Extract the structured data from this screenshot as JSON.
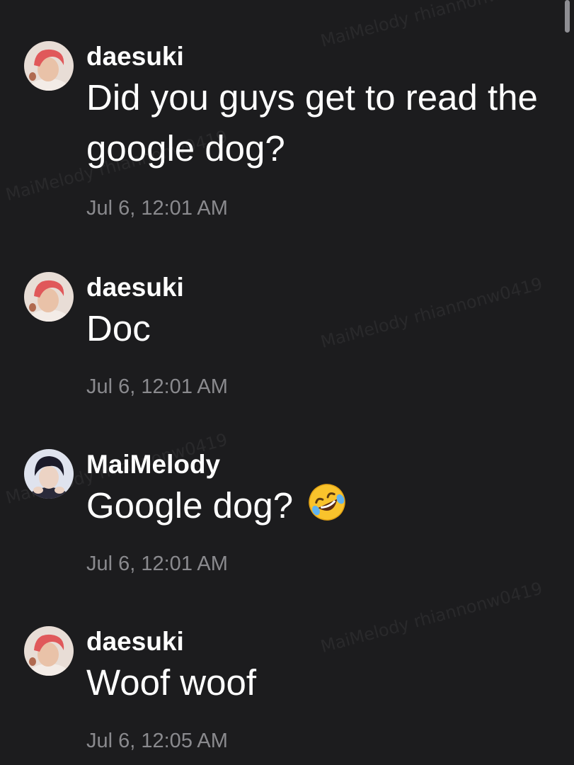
{
  "watermark_text": "MaiMelody rhiannonw0419",
  "messages": [
    {
      "user": "daesuki",
      "text": "Did you guys get to read the google dog?",
      "time": "Jul 6, 12:01 AM",
      "avatar": "daesuki-avatar",
      "emoji": ""
    },
    {
      "user": "daesuki",
      "text": "Doc",
      "time": "Jul 6, 12:01 AM",
      "avatar": "daesuki-avatar",
      "emoji": ""
    },
    {
      "user": "MaiMelody",
      "text": "Google dog?",
      "time": "Jul 6, 12:01 AM",
      "avatar": "maimelody-avatar",
      "emoji": "rolling-on-floor-laughing"
    },
    {
      "user": "daesuki",
      "text": "Woof woof",
      "time": "Jul 6, 12:05 AM",
      "avatar": "daesuki-avatar",
      "emoji": ""
    }
  ],
  "colors": {
    "background": "#1c1c1e",
    "text": "#ffffff",
    "timestamp": "#8a8a8e"
  }
}
